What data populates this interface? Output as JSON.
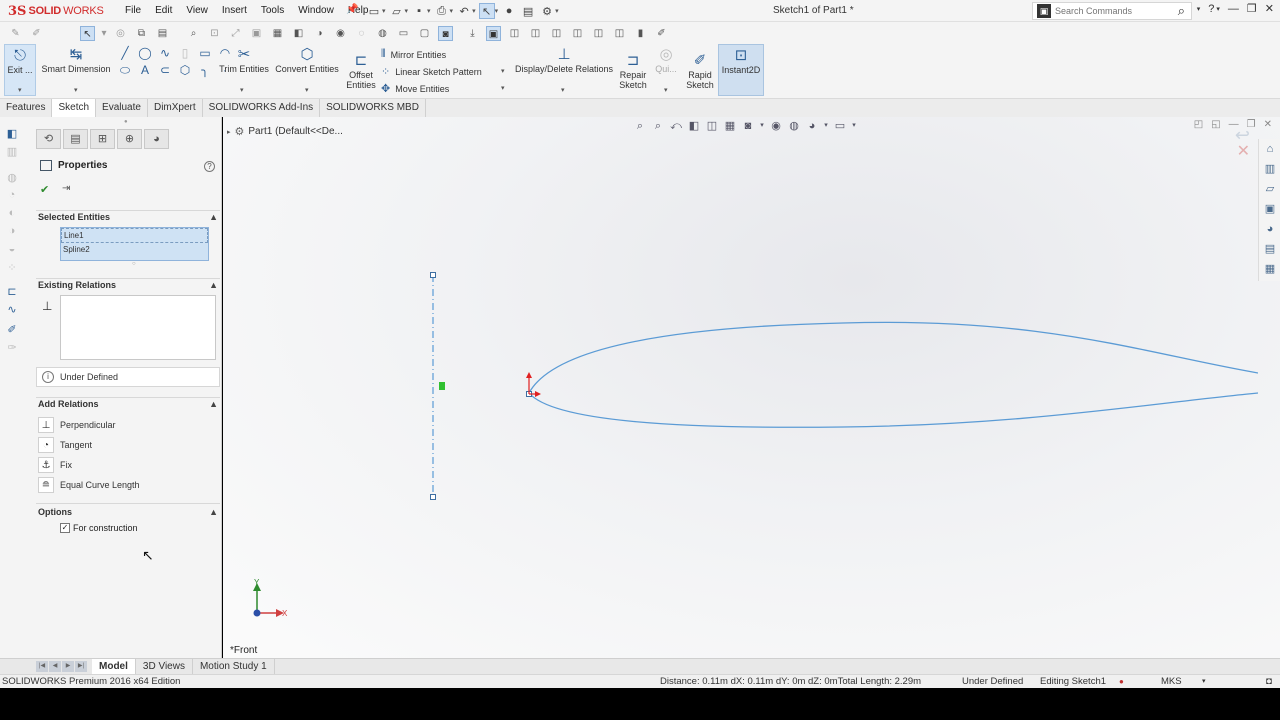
{
  "app": {
    "brand_ds": "3S",
    "brand_solid": "SOLID",
    "brand_works": "WORKS",
    "document_title": "Sketch1 of Part1 *",
    "search_placeholder": "Search Commands",
    "help_label": "?"
  },
  "menu": [
    "File",
    "Edit",
    "View",
    "Insert",
    "Tools",
    "Window",
    "Help"
  ],
  "ribbon": {
    "exit_label": "Exit ...",
    "smart_dimension": "Smart Dimension",
    "trim_entities": "Trim Entities",
    "convert_entities": "Convert Entities",
    "offset_entities_1": "Offset",
    "offset_entities_2": "Entities",
    "mirror_entities": "Mirror Entities",
    "linear_sketch_pattern": "Linear Sketch Pattern",
    "move_entities": "Move Entities",
    "display_delete_relations": "Display/Delete Relations",
    "repair_sketch_1": "Repair",
    "repair_sketch_2": "Sketch",
    "quick_snaps": "Qui...",
    "rapid_sketch_1": "Rapid",
    "rapid_sketch_2": "Sketch",
    "instant2d": "Instant2D"
  },
  "tabs": [
    "Features",
    "Sketch",
    "Evaluate",
    "DimXpert",
    "SOLIDWORKS Add-Ins",
    "SOLIDWORKS MBD"
  ],
  "active_tab": "Sketch",
  "property_manager": {
    "title": "Properties",
    "selected_entities_header": "Selected Entities",
    "selected_entities": [
      "Line1",
      "Spline2"
    ],
    "existing_relations_header": "Existing Relations",
    "status": "Under Defined",
    "add_relations_header": "Add Relations",
    "add_relations": [
      "Perpendicular",
      "Tangent",
      "Fix",
      "Equal Curve Length"
    ],
    "options_header": "Options",
    "for_construction_label": "For construction",
    "for_construction_checked": true
  },
  "canvas": {
    "tree_label": "Part1  (Default<<De...",
    "view_label": "*Front",
    "axis_x": "X",
    "axis_y": "Y"
  },
  "bottom_tabs": [
    "Model",
    "3D Views",
    "Motion Study 1"
  ],
  "active_bottom_tab": "Model",
  "status_bar": {
    "edition": "SOLIDWORKS Premium 2016 x64 Edition",
    "measure": "Distance: 0.11m   dX: 0.11m   dY: 0m   dZ: 0mTotal Length: 2.29m",
    "definition": "Under Defined",
    "editing": "Editing Sketch1",
    "units": "MKS"
  },
  "colors": {
    "sketch_line": "#5b9bd5",
    "brand_red": "#d12c2c",
    "selection_fill": "#cfe2f4"
  }
}
